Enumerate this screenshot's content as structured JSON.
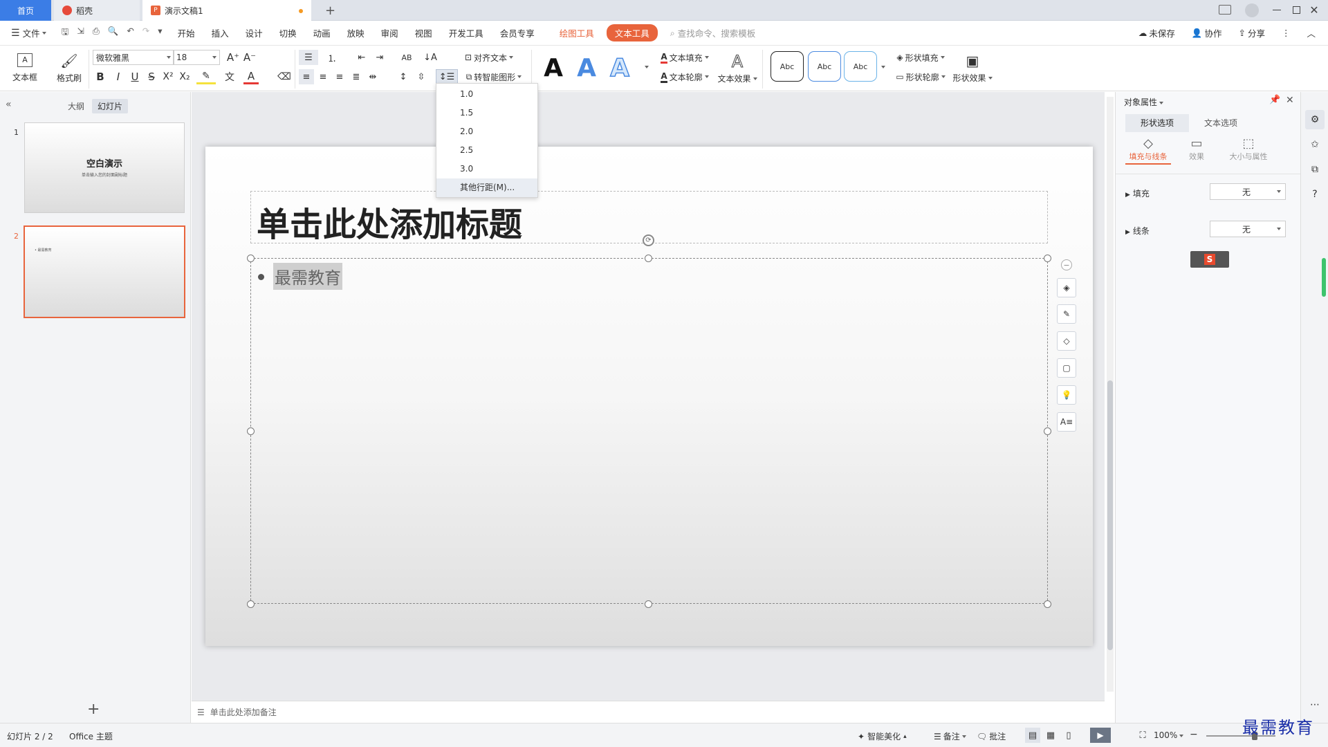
{
  "tabs": {
    "home": "首页",
    "wps": "稻壳",
    "doc": "演示文稿1",
    "new_tab": "+"
  },
  "menu": {
    "file": "文件",
    "items": [
      "开始",
      "插入",
      "设计",
      "切换",
      "动画",
      "放映",
      "审阅",
      "视图",
      "开发工具",
      "会员专享"
    ],
    "drawing_tools": "绘图工具",
    "text_tools": "文本工具",
    "search_placeholder": "查找命令、搜索模板",
    "unsaved": "未保存",
    "collaborate": "协作",
    "share": "分享"
  },
  "ribbon": {
    "textbox": "文本框",
    "format_painter": "格式刷",
    "font_name": "微软雅黑",
    "font_size": "18",
    "align_text": "对齐文本",
    "smart_shape": "转智能图形",
    "text_fill": "文本填充",
    "text_outline": "文本轮廓",
    "text_effect": "文本效果",
    "style_sample": "Abc",
    "shape_fill": "形状填充",
    "shape_outline": "形状轮廓",
    "shape_effect": "形状效果"
  },
  "line_spacing_menu": [
    "1.0",
    "1.5",
    "2.0",
    "2.5",
    "3.0",
    "其他行距(M)..."
  ],
  "left_panel": {
    "tab_outline": "大纲",
    "tab_slides": "幻灯片",
    "slide1_number": "1",
    "slide1_title": "空白演示",
    "slide1_subtitle": "单击输入您的封面副标题",
    "slide2_number": "2",
    "slide2_text": "• 最需教育",
    "add_slide": "+"
  },
  "slide": {
    "title_placeholder": "单击此处添加标题",
    "body_text": "最需教育"
  },
  "notes_placeholder": "单击此处添加备注",
  "right_panel": {
    "title": "对象属性",
    "tab_shape": "形状选项",
    "tab_text": "文本选项",
    "sub_fill_line": "填充与线条",
    "sub_effect": "效果",
    "sub_size": "大小与属性",
    "fill_label": "填充",
    "fill_value": "无",
    "line_label": "线条",
    "line_value": "无"
  },
  "status": {
    "slide_count": "幻灯片 2 / 2",
    "theme": "Office 主题",
    "smart_beautify": "智能美化",
    "notes": "备注",
    "comments": "批注",
    "zoom": "100%"
  },
  "watermark": "最需教育",
  "colors": {
    "accent": "#3b7de6",
    "text_tool": "#e8643c",
    "drawing_tool": "#e8643c",
    "slide_selected": "#e8643c"
  }
}
